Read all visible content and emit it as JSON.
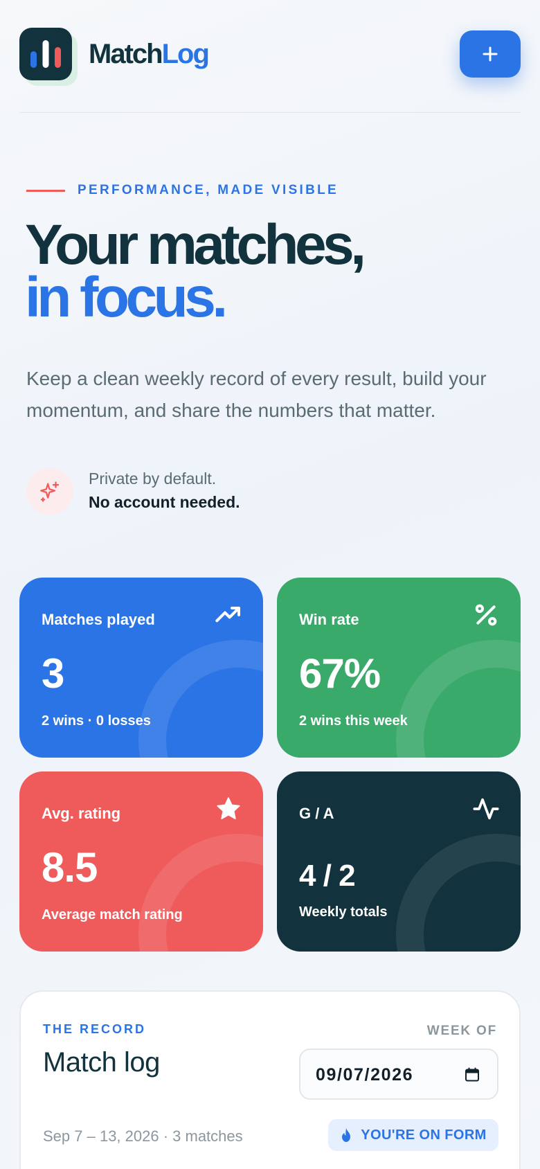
{
  "brand": {
    "part1": "Match",
    "part2": "Log"
  },
  "colors": {
    "primary": "#2b74e6",
    "dark": "#12333d",
    "green": "#3aaa6b",
    "red": "#ef5b5b"
  },
  "header": {
    "add_icon": "plus-icon"
  },
  "hero": {
    "eyebrow": "PERFORMANCE, MADE VISIBLE",
    "headline_line1": "Your matches,",
    "headline_line2": "in focus.",
    "lead": "Keep a clean weekly record of every result, build your momentum, and share the numbers that matter.",
    "privacy_line1": "Private by default.",
    "privacy_line2": "No account needed.",
    "privacy_icon": "sparkles-icon"
  },
  "stats": [
    {
      "label": "Matches played",
      "value": "3",
      "sub": "2 wins · 0 losses",
      "icon": "trending-up-icon"
    },
    {
      "label": "Win rate",
      "value": "67%",
      "sub": "2 wins this week",
      "icon": "percent-icon"
    },
    {
      "label": "Avg. rating",
      "value": "8.5",
      "sub": "Average match rating",
      "icon": "star-icon"
    },
    {
      "label": "G / A",
      "value": "4 / 2",
      "sub": "Weekly totals",
      "icon": "activity-icon"
    }
  ],
  "record": {
    "kicker": "THE RECORD",
    "title": "Match log",
    "week_label": "WEEK OF",
    "week_value": "09/07/2026",
    "range": "Sep 7 – 13, 2026 · 3 matches",
    "form_badge": "YOU'RE ON FORM",
    "form_icon": "flame-icon"
  }
}
